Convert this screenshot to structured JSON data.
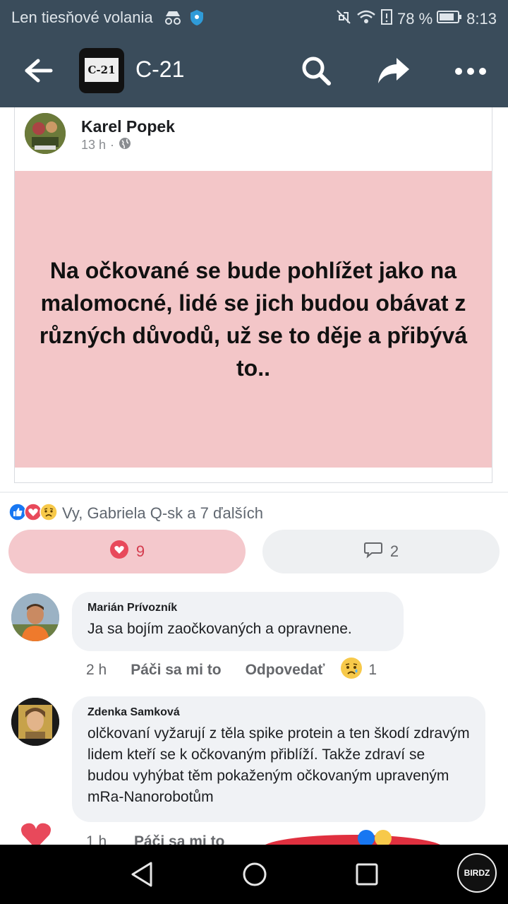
{
  "status_bar": {
    "carrier": "Len tiesňové volania",
    "battery": "78 %",
    "time": "8:13"
  },
  "app_bar": {
    "logo_text": "C-21",
    "title": "C-21",
    "icons": [
      "back-arrow-icon",
      "search-icon",
      "share-icon",
      "more-icon"
    ]
  },
  "post": {
    "author": "Karel Popek",
    "time": "13 h",
    "privacy_separator": "·",
    "text": "Na očkované se bude pohlížet jako na malomocné, lidé se jich budou obávat z různých důvodů, už se to děje a přibývá to..",
    "background_color": "#f3c6c8"
  },
  "reactions": {
    "summary": "Vy, Gabriela Q-sk a 7 ďalších",
    "love_count": "9",
    "comment_count": "2"
  },
  "comments": [
    {
      "name": "Marián Prívozník",
      "text": "Ja sa bojím zaočkovaných a opravnene.",
      "time": "2 h",
      "like_label": "Páči sa mi to",
      "reply_label": "Odpovedať",
      "reaction_count": "1"
    },
    {
      "name": "Zdenka Samková",
      "text": "olčkovaní vyžarují z těla spike protein a ten škodí zdravým lidem kteří se k očkovaným přiblíží. Takže zdraví se budou vyhýbat těm pokaženým očkovaným upraveným mRa-Nanorobotům",
      "time": "1 h",
      "like_label": "Páči sa mi to"
    }
  ],
  "watermark": "BIRDZ",
  "colors": {
    "header": "#3a4c5b",
    "love": "#e8495b",
    "like": "#1877f2"
  }
}
